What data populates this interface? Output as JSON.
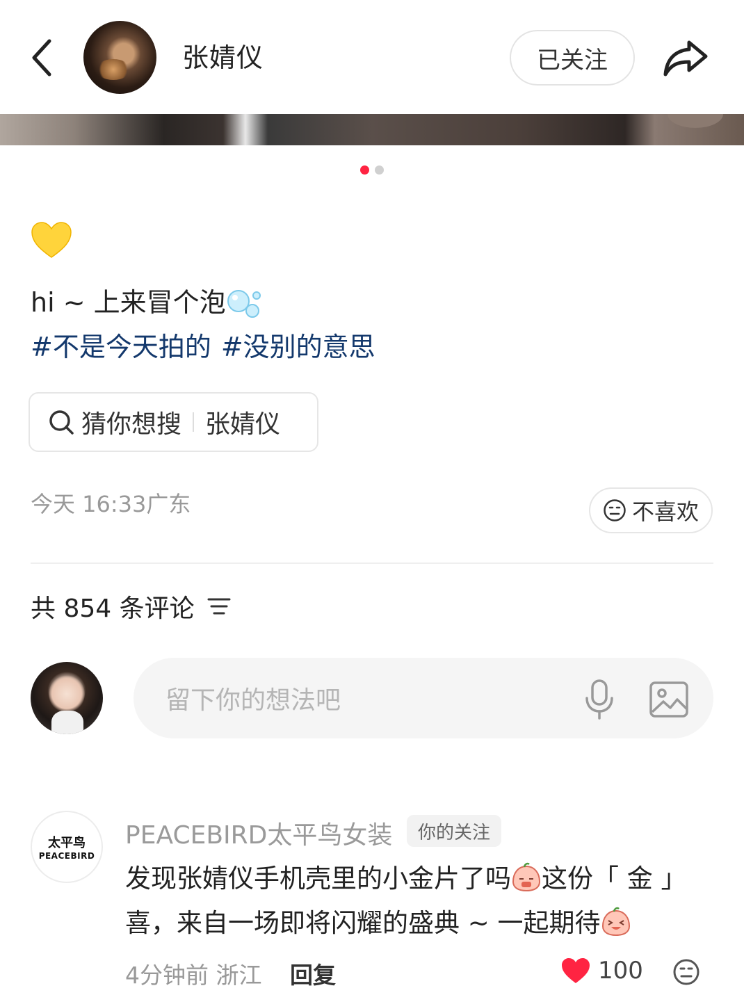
{
  "header": {
    "author_name": "张婧仪",
    "follow_label": "已关注",
    "icons": {
      "back": "chevron-left-icon",
      "share": "share-arrow-icon"
    }
  },
  "carousel": {
    "total": 2,
    "active_index": 0
  },
  "post": {
    "emoji": "yellow-heart-icon",
    "caption": "hi ~ 上来冒个泡",
    "tags": [
      "#不是今天拍的",
      "#没别的意思"
    ],
    "suggest": {
      "label": "猜你想搜",
      "term": "张婧仪"
    },
    "time": "今天 16:33",
    "location": "广东",
    "dislike_label": "不喜欢"
  },
  "comments": {
    "count_label": "共 854 条评论",
    "input_placeholder": "留下你的想法吧",
    "items": [
      {
        "author": "PEACEBIRD太平鸟女装",
        "avatar_cn": "太平鸟",
        "avatar_en": "PEACEBIRD",
        "badge": "你的关注",
        "text_1": "发现张婧仪手机壳里的小金片了吗",
        "text_2": "这份「 金 」",
        "text_3": "喜，来自一场即将闪耀的盛典 ~ 一起期待",
        "time": "4分钟前",
        "location": "浙江",
        "reply_label": "回复",
        "likes": "100"
      }
    ]
  },
  "colors": {
    "accent": "#ff2442",
    "tag": "#13386c",
    "muted": "#999999"
  }
}
